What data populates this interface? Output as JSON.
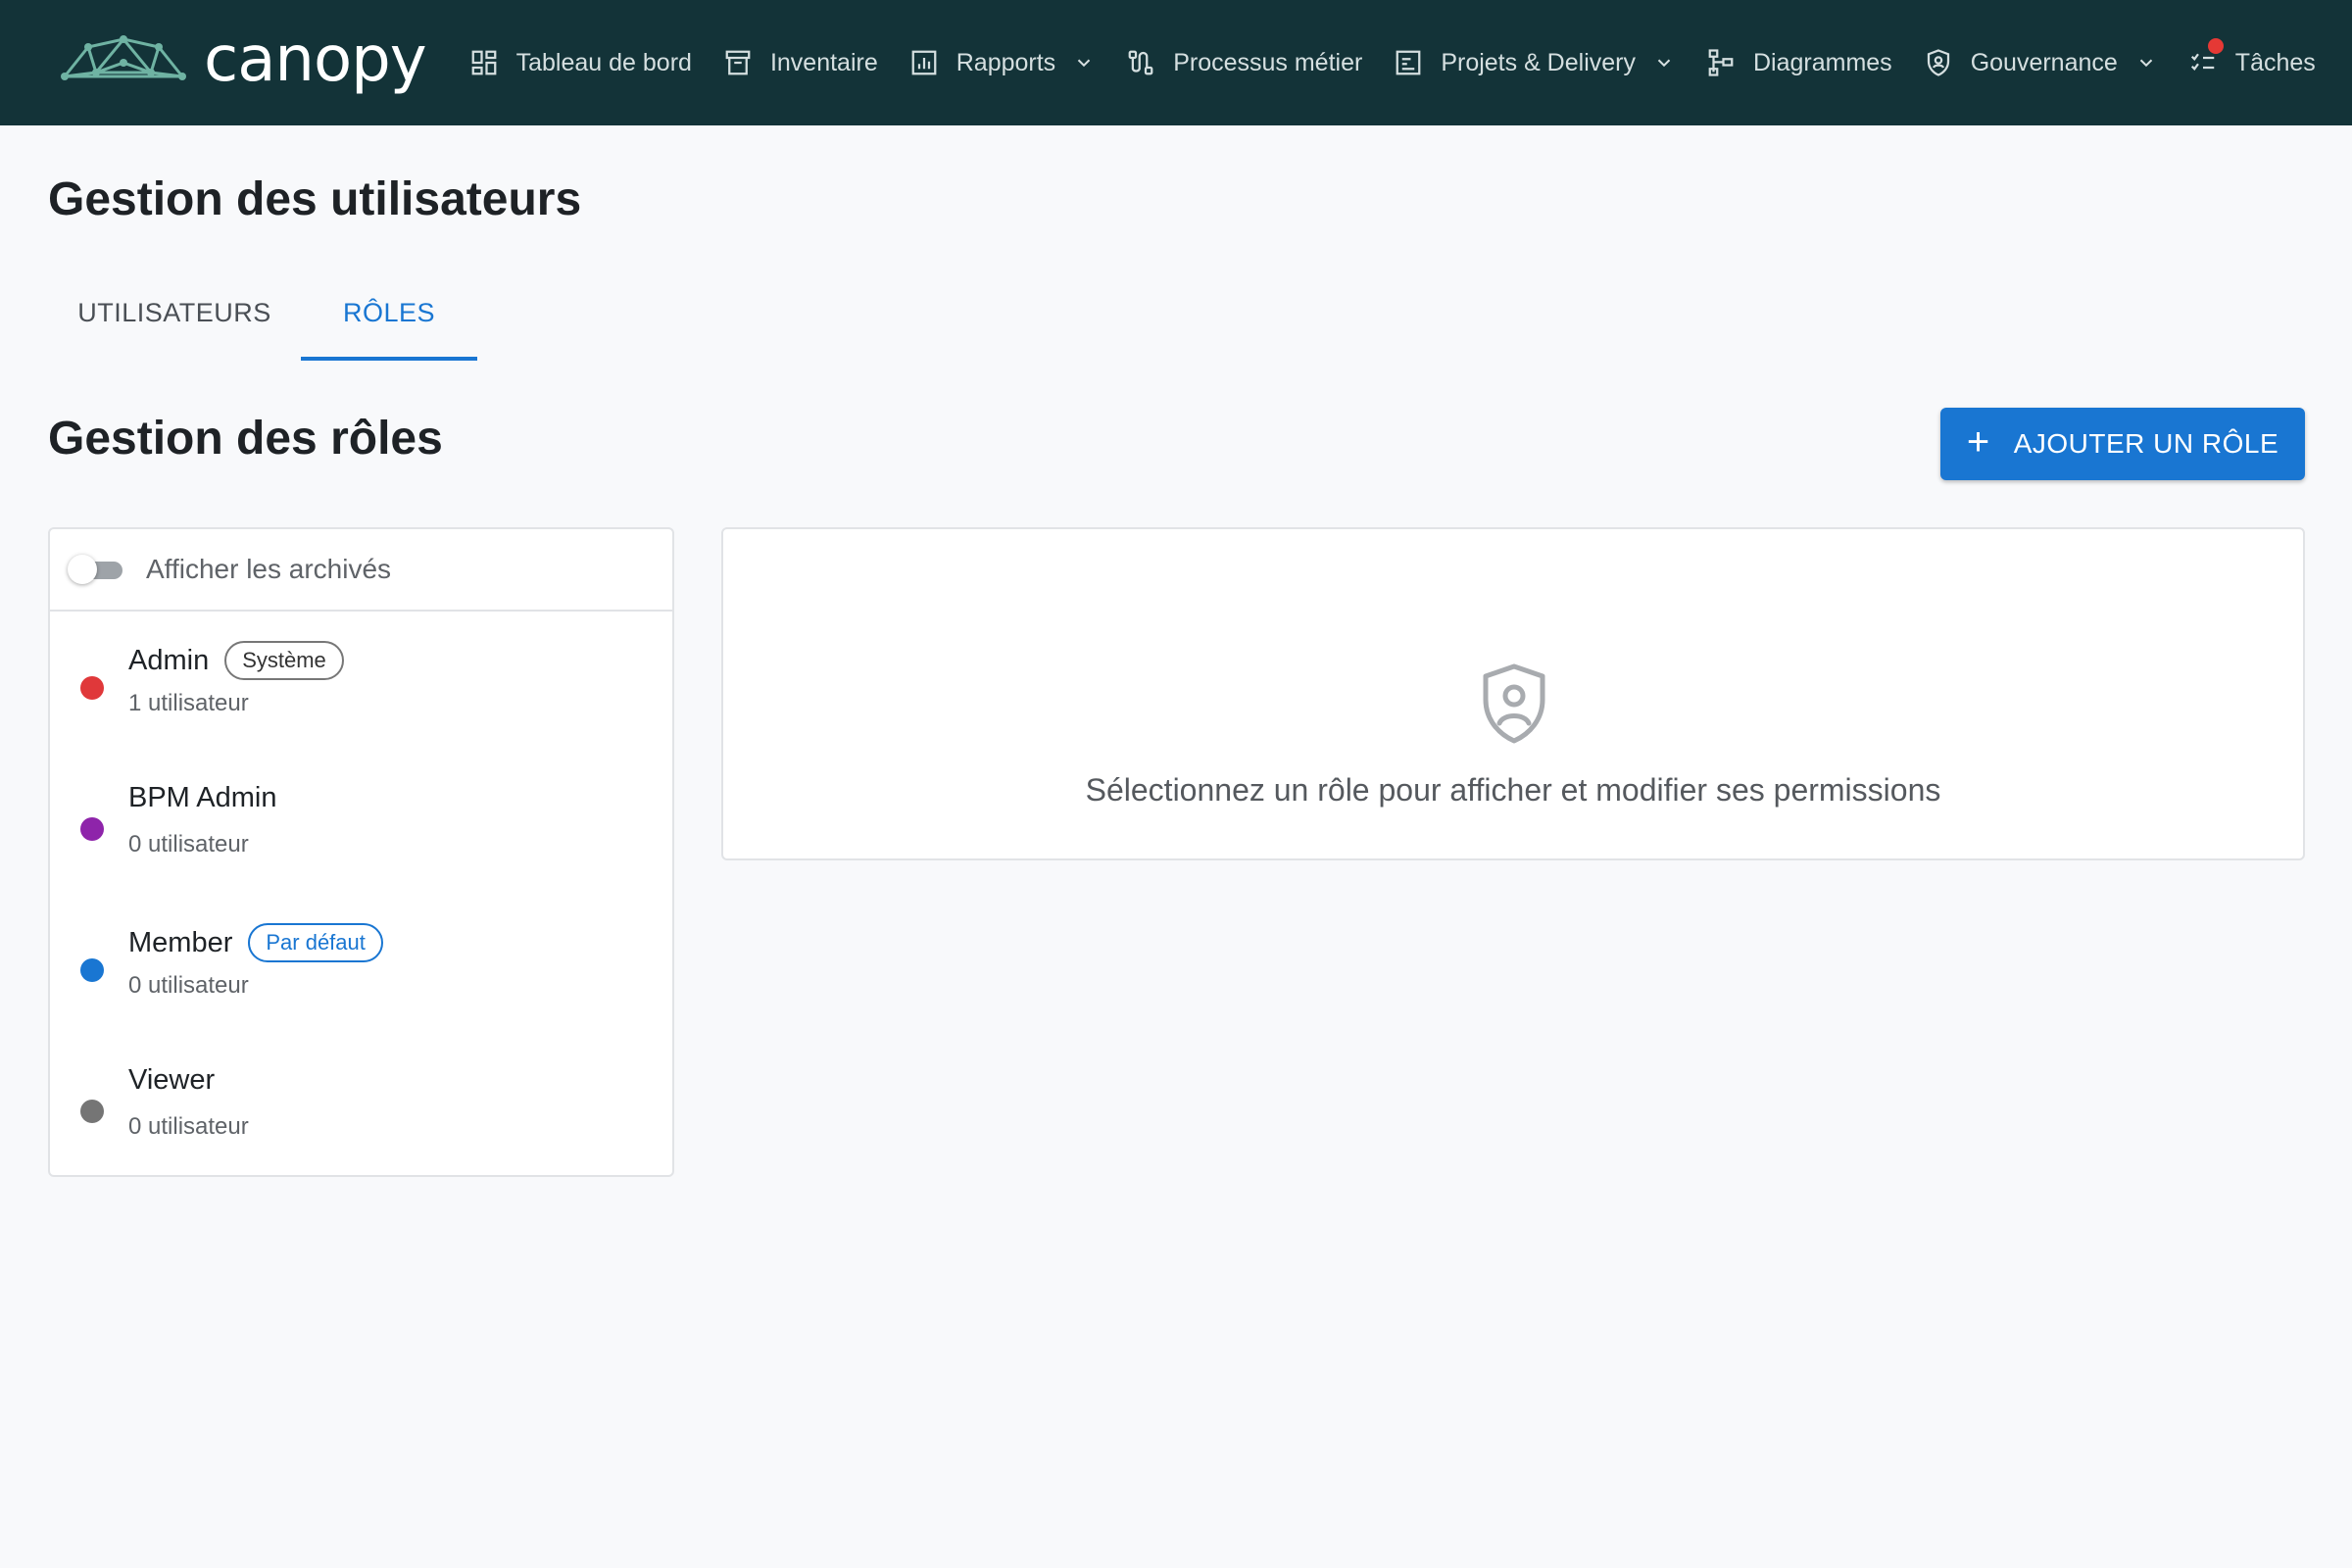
{
  "brand": {
    "name": "canopy"
  },
  "nav": {
    "items": [
      {
        "label": "Tableau de bord",
        "icon": "dashboard-icon"
      },
      {
        "label": "Inventaire",
        "icon": "archive-box-icon"
      },
      {
        "label": "Rapports",
        "icon": "bar-chart-icon",
        "has_dropdown": true
      },
      {
        "label": "Processus métier",
        "icon": "route-icon"
      },
      {
        "label": "Projets & Delivery",
        "icon": "project-icon",
        "has_dropdown": true
      },
      {
        "label": "Diagrammes",
        "icon": "hierarchy-icon"
      },
      {
        "label": "Gouvernance",
        "icon": "shield-icon",
        "has_dropdown": true
      },
      {
        "label": "Tâches",
        "icon": "checklist-icon",
        "notification": true
      }
    ]
  },
  "page": {
    "title": "Gestion des utilisateurs"
  },
  "tabs": [
    {
      "label": "UTILISATEURS",
      "active": false
    },
    {
      "label": "RÔLES",
      "active": true
    }
  ],
  "section": {
    "title": "Gestion des rôles",
    "add_button_label": "AJOUTER UN RÔLE",
    "add_button_icon": "plus-icon"
  },
  "roles_panel": {
    "archive_toggle_label": "Afficher les archivés",
    "archive_toggle_on": false,
    "roles": [
      {
        "name": "Admin",
        "badge": "Système",
        "badge_type": "system",
        "count": "1 utilisateur",
        "color": "#e0383a"
      },
      {
        "name": "BPM Admin",
        "badge": "",
        "badge_type": "",
        "count": "0 utilisateur",
        "color": "#8e24aa"
      },
      {
        "name": "Member",
        "badge": "Par défaut",
        "badge_type": "default",
        "count": "0 utilisateur",
        "color": "#1976d2"
      },
      {
        "name": "Viewer",
        "badge": "",
        "badge_type": "",
        "count": "0 utilisateur",
        "color": "#757575"
      }
    ]
  },
  "detail_panel": {
    "icon": "shield-user-icon",
    "message": "Sélectionnez un rôle pour afficher et modifier ses permissions"
  },
  "colors": {
    "topbar": "#133338",
    "accent": "#1976d2",
    "background": "#f8f9fb"
  }
}
